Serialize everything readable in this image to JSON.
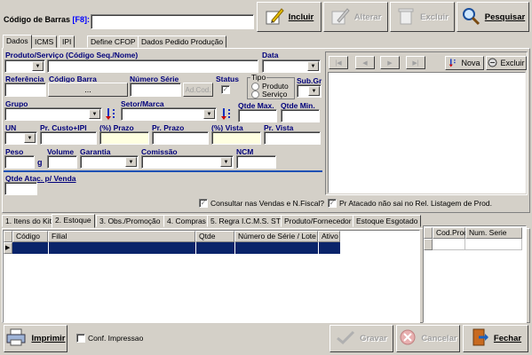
{
  "header": {
    "barcode_label": "Código de Barras",
    "barcode_key": "[F8]:",
    "barcode_value": "",
    "buttons": {
      "incluir": "Incluir",
      "alterar": "Alterar",
      "excluir": "Excluir",
      "pesquisar": "Pesquisar"
    }
  },
  "top_tabs": [
    "Dados",
    "ICMS",
    "IPI",
    "Define CFOP",
    "Dados Pedido Produção"
  ],
  "form": {
    "produto_label": "Produto/Serviço  (Código Seq./Nome)",
    "data_label": "Data",
    "referencia_label": "Referência",
    "codigo_barra_label": "Código Barra",
    "codigo_barra_btn": "...",
    "numero_serie_label": "Número Série",
    "adcod_btn": "Ad.Cod.",
    "status_label": "Status",
    "tipo_label": "Tipo",
    "tipo_options": [
      "Produto",
      "Serviço"
    ],
    "subgr_label": "Sub.Gr",
    "grupo_label": "Grupo",
    "setor_label": "Setor/Marca",
    "qtde_max_label": "Qtde Max.",
    "qtde_min_label": "Qtde Min.",
    "un_label": "UN",
    "custo_label": "Pr. Custo+IPI",
    "prazo_pct_label": "(%) Prazo",
    "pr_prazo_label": "Pr. Prazo",
    "vista_pct_label": "(%) Vista",
    "pr_vista_label": "Pr. Vista",
    "peso_label": "Peso",
    "peso_unit": "g",
    "volume_label": "Volume",
    "garantia_label": "Garantia",
    "comissao_label": "Comissão",
    "ncm_label": "NCM",
    "qtde_atac_label": "Qtde Atac. p/ Venda",
    "consultar_label": "Consultar nas Vendas e N.Fiscal?",
    "atacado_label": "Pr Atacado não sai no Rel. Listagem de Prod."
  },
  "right_panel": {
    "nova_label": "Nova",
    "excluir_label": "Excluir"
  },
  "bottom_tabs": [
    "1. Itens do Kit",
    "2. Estoque",
    "3. Obs./Promoção",
    "4. Compras",
    "5. Regra I.C.M.S. ST",
    "Produto/Fornecedor",
    "Estoque Esgotado"
  ],
  "estoque_table": {
    "columns": [
      "Código",
      "Filial",
      "Qtde",
      "Número de Série / Lote",
      "Ativo"
    ]
  },
  "serie_table": {
    "columns": [
      "Cod.Prod.",
      "Num. Serie"
    ]
  },
  "footer": {
    "imprimir": "Imprimir",
    "conf_impressao": "Conf. Impressao",
    "gravar": "Gravar",
    "cancelar": "Cancelar",
    "fechar": "Fechar"
  },
  "colors": {
    "label_blue": "#00007b",
    "selected_row": "#0a246a",
    "separator": "#1e50b4",
    "panel_bg": "#d4d0c8"
  }
}
